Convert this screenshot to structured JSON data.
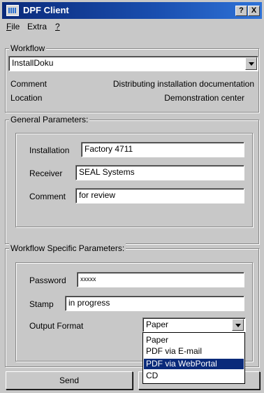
{
  "window": {
    "title": "DPF Client",
    "help_btn": "?",
    "close_btn": "X"
  },
  "menu": [
    {
      "label": "File",
      "underline": "F",
      "rest": "ile"
    },
    {
      "label": "Extra",
      "underline": "",
      "rest": "Extra"
    },
    {
      "label": "?",
      "underline": "?",
      "rest": ""
    }
  ],
  "workflow": {
    "legend": "Workflow",
    "selected": "InstallDoku",
    "comment_label": "Comment",
    "comment_value": "Distributing installation documentation",
    "location_label": "Location",
    "location_value": "Demonstration center"
  },
  "general": {
    "legend": "General Parameters:",
    "installation_label": "Installation",
    "installation_value": "Factory 4711",
    "receiver_label": "Receiver",
    "receiver_value": "SEAL Systems",
    "comment_label": "Comment",
    "comment_value": "for review"
  },
  "specific": {
    "legend": "Workflow Specific Parameters:",
    "password_label": "Password",
    "password_value": "xxxxx",
    "stamp_label": "Stamp",
    "stamp_value": "in progress",
    "output_label": "Output Format",
    "output_selected": "Paper",
    "output_options": [
      "Paper",
      "PDF via E-mail",
      "PDF via WebPortal",
      "CD"
    ],
    "highlighted_option": "PDF via WebPortal"
  },
  "buttons": {
    "send": "Send"
  },
  "colors": {
    "titlebar": "#0a2a7a",
    "selection": "#0a2a7a",
    "window_bg": "#c8c8c8",
    "desktop": "#1a84c0"
  }
}
